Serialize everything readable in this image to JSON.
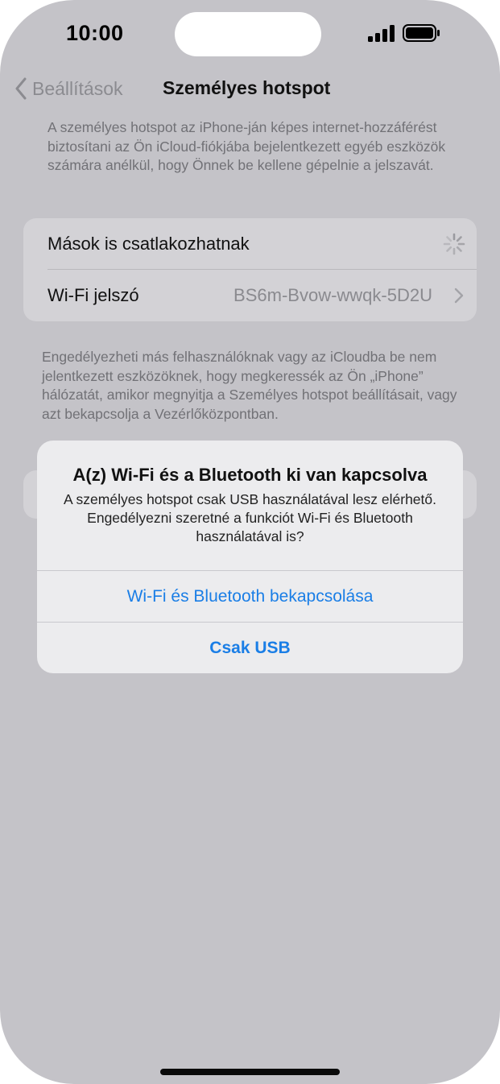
{
  "status_bar": {
    "time": "10:00"
  },
  "nav": {
    "back_label": "Beállítások",
    "title": "Személyes hotspot"
  },
  "description_top": "A személyes hotspot az iPhone-ján képes internet-hozzáférést biztosítani az Ön iCloud-fiókjába bejelentkezett egyéb eszközök számára anélkül, hogy Önnek be kellene gépelnie a jelszavát.",
  "settings": {
    "allow_others_label": "Mások is csatlakozhatnak",
    "wifi_password_label": "Wi-Fi jelszó",
    "wifi_password_value": "BS6m-Bvow-wwqk-5D2U"
  },
  "description_bottom": "Engedélyezheti más felhasználóknak vagy az iCloudba be nem jelentkezett eszközöknek, hogy megkeressék az Ön „iPhone” hálózatát, amikor megnyitja a Személyes hotspot beállításait, vagy azt bekapcsolja a Vezérlőközpontban.",
  "alert": {
    "title": "A(z) Wi-Fi és a Bluetooth ki van kapcsolva",
    "message": "A személyes hotspot csak USB használatával lesz elérhető. Engedélyezni szeretné a funkciót Wi-Fi és Bluetooth használatával is?",
    "primary_button": "Wi-Fi és Bluetooth bekapcsolása",
    "secondary_button": "Csak USB"
  },
  "colors": {
    "accent": "#1a7ee6",
    "dimmed_background": "#c4c3c8"
  }
}
